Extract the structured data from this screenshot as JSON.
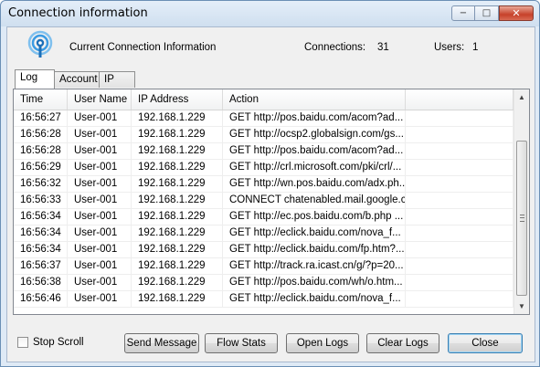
{
  "window": {
    "title": "Connection information",
    "min_glyph": "−",
    "max_glyph": "□",
    "close_glyph": "✕"
  },
  "header": {
    "label": "Current Connection Information",
    "connections_label": "Connections:",
    "connections_value": "31",
    "users_label": "Users:",
    "users_value": "1"
  },
  "tabs": [
    {
      "label": "Log",
      "active": true
    },
    {
      "label": "Account",
      "active": false
    },
    {
      "label": "IP",
      "active": false
    }
  ],
  "table": {
    "columns": [
      "Time",
      "User Name",
      "IP Address",
      "Action",
      ""
    ],
    "rows": [
      [
        "16:56:27",
        "User-001",
        "192.168.1.229",
        "GET http://pos.baidu.com/acom?ad..."
      ],
      [
        "16:56:28",
        "User-001",
        "192.168.1.229",
        "GET http://ocsp2.globalsign.com/gs..."
      ],
      [
        "16:56:28",
        "User-001",
        "192.168.1.229",
        "GET http://pos.baidu.com/acom?ad..."
      ],
      [
        "16:56:29",
        "User-001",
        "192.168.1.229",
        "GET http://crl.microsoft.com/pki/crl/..."
      ],
      [
        "16:56:32",
        "User-001",
        "192.168.1.229",
        "GET http://wn.pos.baidu.com/adx.ph..."
      ],
      [
        "16:56:33",
        "User-001",
        "192.168.1.229",
        "CONNECT chatenabled.mail.google.c..."
      ],
      [
        "16:56:34",
        "User-001",
        "192.168.1.229",
        "GET http://ec.pos.baidu.com/b.php ..."
      ],
      [
        "16:56:34",
        "User-001",
        "192.168.1.229",
        "GET http://eclick.baidu.com/nova_f..."
      ],
      [
        "16:56:34",
        "User-001",
        "192.168.1.229",
        "GET http://eclick.baidu.com/fp.htm?..."
      ],
      [
        "16:56:37",
        "User-001",
        "192.168.1.229",
        "GET http://track.ra.icast.cn/g/?p=20..."
      ],
      [
        "16:56:38",
        "User-001",
        "192.168.1.229",
        "GET http://pos.baidu.com/wh/o.htm..."
      ],
      [
        "16:56:46",
        "User-001",
        "192.168.1.229",
        "GET http://eclick.baidu.com/nova_f..."
      ]
    ]
  },
  "scrollbar": {
    "up_glyph": "▲",
    "down_glyph": "▼"
  },
  "footer": {
    "stop_scroll_label": "Stop Scroll",
    "stop_scroll_checked": false,
    "buttons": [
      "Send Message",
      "Flow Stats",
      "Open Logs",
      "Clear Logs",
      "Close"
    ]
  },
  "colors": {
    "icon_blue": "#2f8fd8",
    "window_border": "#6b8fb5",
    "close_red": "#c7412a"
  }
}
